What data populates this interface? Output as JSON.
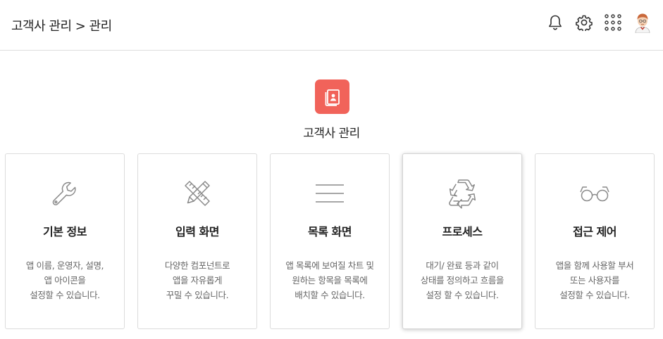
{
  "header": {
    "breadcrumb": "고객사 관리 > 관리",
    "icons": [
      "bell-icon",
      "gear-icon",
      "apps-grid-icon",
      "avatar"
    ]
  },
  "app": {
    "title": "고객사 관리",
    "icon": "contact-book-icon",
    "icon_color": "#f1635a"
  },
  "cards": [
    {
      "title": "기본 정보",
      "desc": "앱 이름, 운영자, 설명,\n앱 아이콘을\n설정할 수 있습니다.",
      "icon": "wrench-icon"
    },
    {
      "title": "입력 화면",
      "desc": "다양한 컴포넌트로\n앱을 자유롭게\n꾸밀 수 있습니다.",
      "icon": "pencil-ruler-icon"
    },
    {
      "title": "목록 화면",
      "desc": "앱 목록에 보여질 차트 및\n원하는 항목을 목록에\n배치할 수 있습니다.",
      "icon": "list-lines-icon"
    },
    {
      "title": "프로세스",
      "desc": "대기/ 완료 등과 같이\n상태를 정의하고 흐름을\n설정 할 수 있습니다.",
      "icon": "recycle-icon"
    },
    {
      "title": "접근 제어",
      "desc": "앱을 함께 사용할 부서\n또는 사용자를\n설정할 수 있습니다.",
      "icon": "glasses-icon"
    }
  ]
}
